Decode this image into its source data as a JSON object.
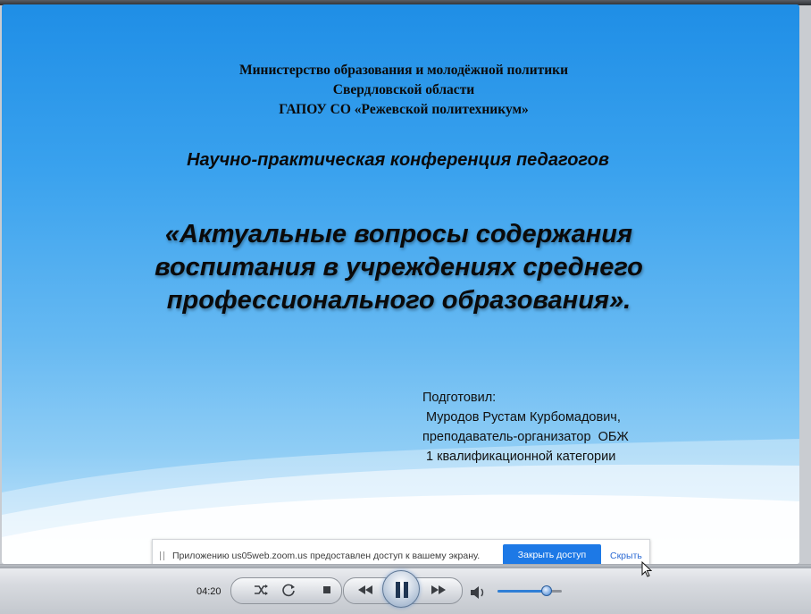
{
  "slide": {
    "ministry_lines": [
      "Министерство образования и молодёжной политики",
      "Свердловской области",
      "ГАПОУ СО «Режевской политехникум»"
    ],
    "conference": "Научно-практическая конференция педагогов",
    "topic_lines": [
      "«Актуальные вопросы содержания",
      "воспитания в учреждениях среднего",
      "профессионального образования»."
    ],
    "author_lines": [
      "Подготовил:",
      " Муродов Рустам Курбомадович,",
      "преподаватель-организатор  ОБЖ",
      " 1 квалификационной категории"
    ]
  },
  "share_bar": {
    "message": "Приложению us05web.zoom.us предоставлен доступ к вашему экрану.",
    "stop_label": "Закрыть доступ",
    "hide_label": "Скрыть"
  },
  "player": {
    "time": "04:20",
    "seek_progress": 0.0,
    "volume_level": 0.75
  },
  "colors": {
    "share_button": "#1d79e6",
    "link": "#2d6bd4"
  },
  "icons": [
    "shuffle-icon",
    "repeat-icon",
    "stop-icon",
    "previous-icon",
    "pause-icon",
    "next-icon",
    "volume-icon",
    "mouse-cursor-icon"
  ]
}
